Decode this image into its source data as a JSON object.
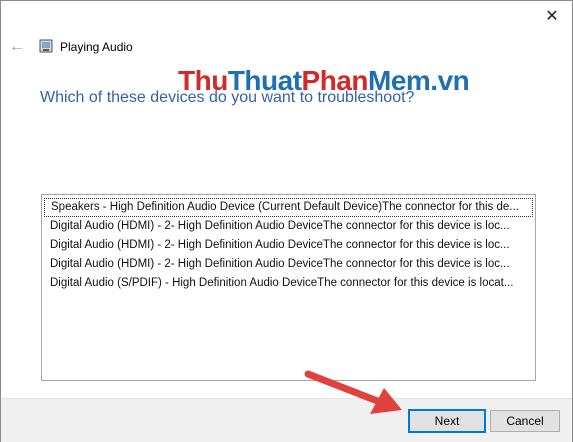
{
  "window": {
    "title": "Playing Audio",
    "close_glyph": "✕",
    "back_glyph": "←"
  },
  "watermark": {
    "part1": "Thu",
    "part2": "Thuat",
    "part3": "Phan",
    "part4": "Mem",
    "part5": ".vn"
  },
  "heading": "Which of these devices do you want to troubleshoot?",
  "devices": [
    "Speakers - High Definition Audio Device (Current Default Device)The connector for this de...",
    "Digital Audio (HDMI) - 2- High Definition Audio DeviceThe connector for this device is loc...",
    "Digital Audio (HDMI) - 2- High Definition Audio DeviceThe connector for this device is loc...",
    "Digital Audio (HDMI) - 2- High Definition Audio DeviceThe connector for this device is loc...",
    "Digital Audio (S/PDIF) - High Definition Audio DeviceThe connector for this device is locat..."
  ],
  "buttons": {
    "next": "Next",
    "cancel": "Cancel"
  },
  "colors": {
    "heading": "#1f4fa0",
    "arrow": "#e0413a",
    "focus": "#0078d7"
  }
}
